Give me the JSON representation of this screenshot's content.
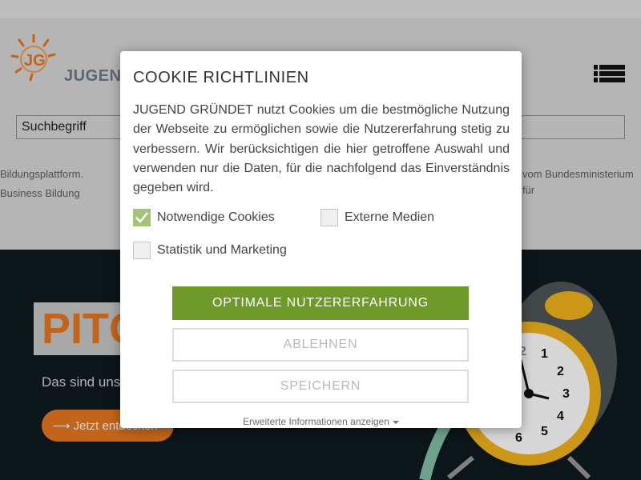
{
  "brand": {
    "name": "JUGEND",
    "logo_letters": "JG"
  },
  "search": {
    "placeholder": "Suchbegriff"
  },
  "tagline": {
    "left": "Bildungsplattform. Business Bildung",
    "right": "vom Bundesministerium für"
  },
  "hero": {
    "title": "PITC",
    "subtitle": "Das sind uns",
    "button_label": "⟶ Jetzt entdecken"
  },
  "clock_numbers": [
    "1",
    "2",
    "3",
    "4",
    "5",
    "2",
    "6"
  ],
  "cookie_dialog": {
    "title": "COOKIE RICHTLINIEN",
    "text": "JUGEND GRÜNDET nutzt Cookies um die bestmögliche Nutzung der Webseite zu ermöglichen sowie die Nutzererfahrung stetig zu verbessern. Wir berücksichtigen die hier getroffene Auswahl und verwenden nur die Daten, für die nachfolgend das Einverständnis gegeben wird.",
    "options": [
      {
        "label": "Notwendige Cookies",
        "checked": true
      },
      {
        "label": "Externe Medien",
        "checked": false
      },
      {
        "label": "Statistik und Marketing",
        "checked": false
      }
    ],
    "accept_label": "OPTIMALE NUTZERERFAHRUNG",
    "decline_label": "ABLEHNEN",
    "save_label": "SPEICHERN",
    "more_label": "Erweiterte Informationen anzeigen"
  },
  "colors": {
    "accent_green": "#6e9a2b",
    "check_green": "#a5c279",
    "brand_orange": "#e8781e",
    "hero_bg": "#0f1a1f"
  },
  "icons": [
    "logo-icon",
    "menu-icon",
    "checkmark-icon",
    "caret-down-icon",
    "alarm-clock-image"
  ]
}
